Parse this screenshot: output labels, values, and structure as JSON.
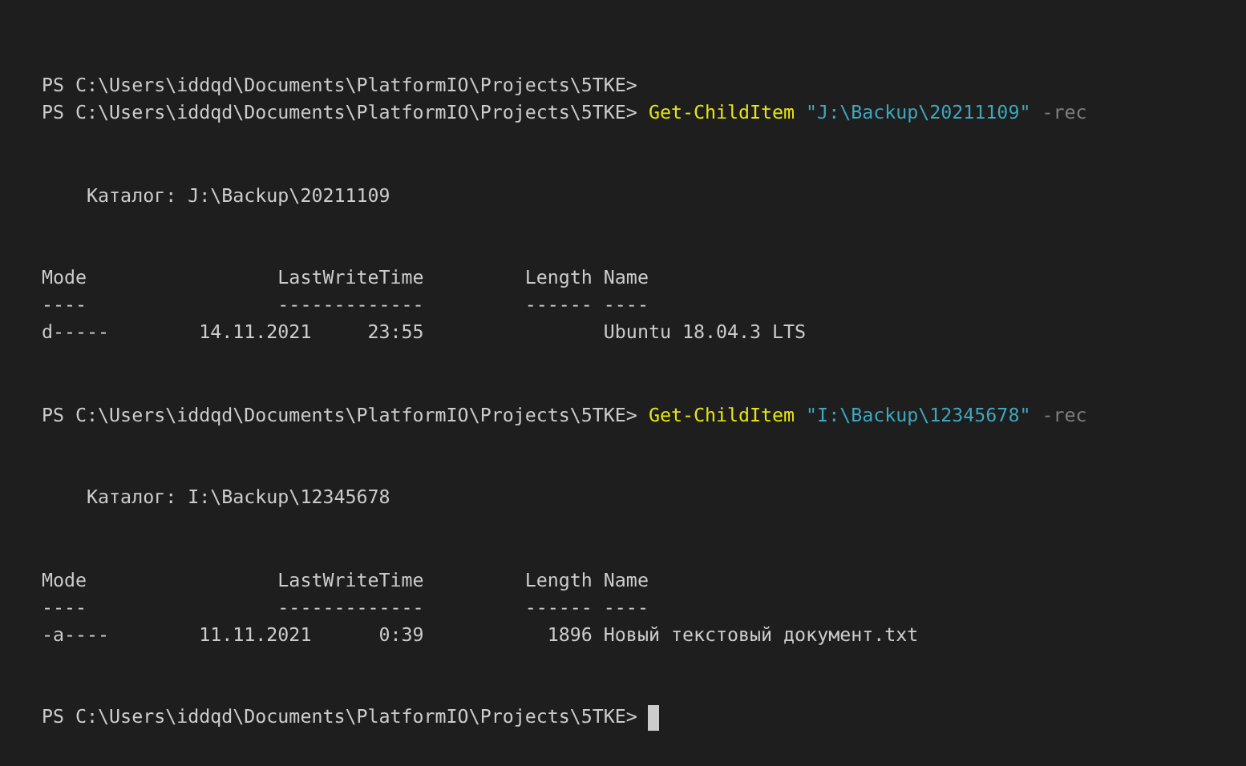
{
  "terminal": {
    "lines": [
      {
        "kind": "prompt",
        "prompt": "PS C:\\Users\\iddqd\\Documents\\PlatformIO\\Projects\\5TKE>"
      },
      {
        "kind": "prompt",
        "prompt": "PS C:\\Users\\iddqd\\Documents\\PlatformIO\\Projects\\5TKE>",
        "command": "Get-ChildItem",
        "argument": "\"J:\\Backup\\20211109\"",
        "parameter": "-rec"
      },
      {
        "kind": "blank"
      },
      {
        "kind": "blank"
      },
      {
        "kind": "output",
        "text": "    Каталог: J:\\Backup\\20211109"
      },
      {
        "kind": "blank"
      },
      {
        "kind": "blank"
      },
      {
        "kind": "output",
        "text": "Mode                 LastWriteTime         Length Name"
      },
      {
        "kind": "output",
        "text": "----                 -------------         ------ ----"
      },
      {
        "kind": "output",
        "text": "d-----        14.11.2021     23:55                Ubuntu 18.04.3 LTS"
      },
      {
        "kind": "blank"
      },
      {
        "kind": "blank"
      },
      {
        "kind": "prompt",
        "prompt": "PS C:\\Users\\iddqd\\Documents\\PlatformIO\\Projects\\5TKE>",
        "command": "Get-ChildItem",
        "argument": "\"I:\\Backup\\12345678\"",
        "parameter": "-rec"
      },
      {
        "kind": "blank"
      },
      {
        "kind": "blank"
      },
      {
        "kind": "output",
        "text": "    Каталог: I:\\Backup\\12345678"
      },
      {
        "kind": "blank"
      },
      {
        "kind": "blank"
      },
      {
        "kind": "output",
        "text": "Mode                 LastWriteTime         Length Name"
      },
      {
        "kind": "output",
        "text": "----                 -------------         ------ ----"
      },
      {
        "kind": "output",
        "text": "-a----        11.11.2021      0:39           1896 Новый текстовый документ.txt"
      },
      {
        "kind": "blank"
      },
      {
        "kind": "blank"
      },
      {
        "kind": "prompt",
        "prompt": "PS C:\\Users\\iddqd\\Documents\\PlatformIO\\Projects\\5TKE>",
        "cursor": true
      }
    ]
  }
}
